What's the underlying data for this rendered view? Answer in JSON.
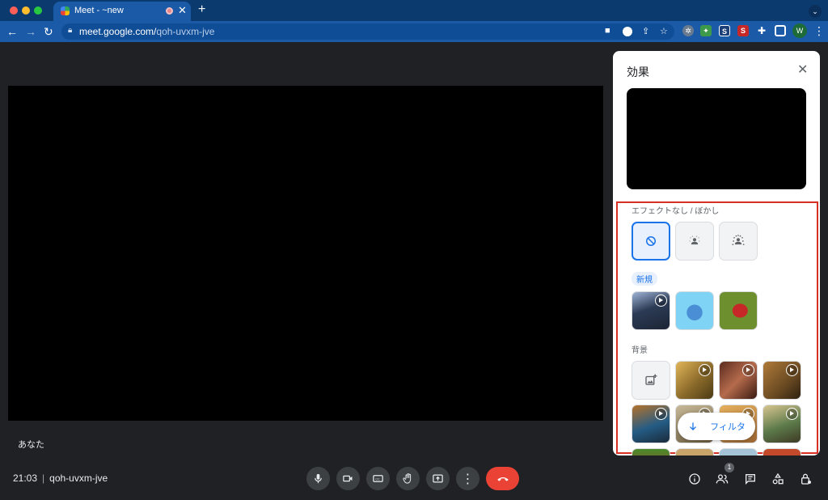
{
  "browser": {
    "tab_title": "Meet - ~new",
    "url_host": "meet.google.com/",
    "url_path": "qoh-uvxm-jve",
    "profile_initial": "W",
    "extensions": [
      "S",
      "S"
    ]
  },
  "meet": {
    "self_name": "あなた",
    "time": "21:03",
    "meeting_code": "qoh-uvxm-jve",
    "participant_count": "1"
  },
  "effects_panel": {
    "title": "効果",
    "section_blur": "エフェクトなし / ぼかし",
    "chip_new": "新規",
    "section_background": "背景",
    "filter_button": "フィルタ"
  },
  "colors": {
    "accent": "#1a73e8",
    "hangup": "#ea4335",
    "highlight": "#d93025"
  }
}
